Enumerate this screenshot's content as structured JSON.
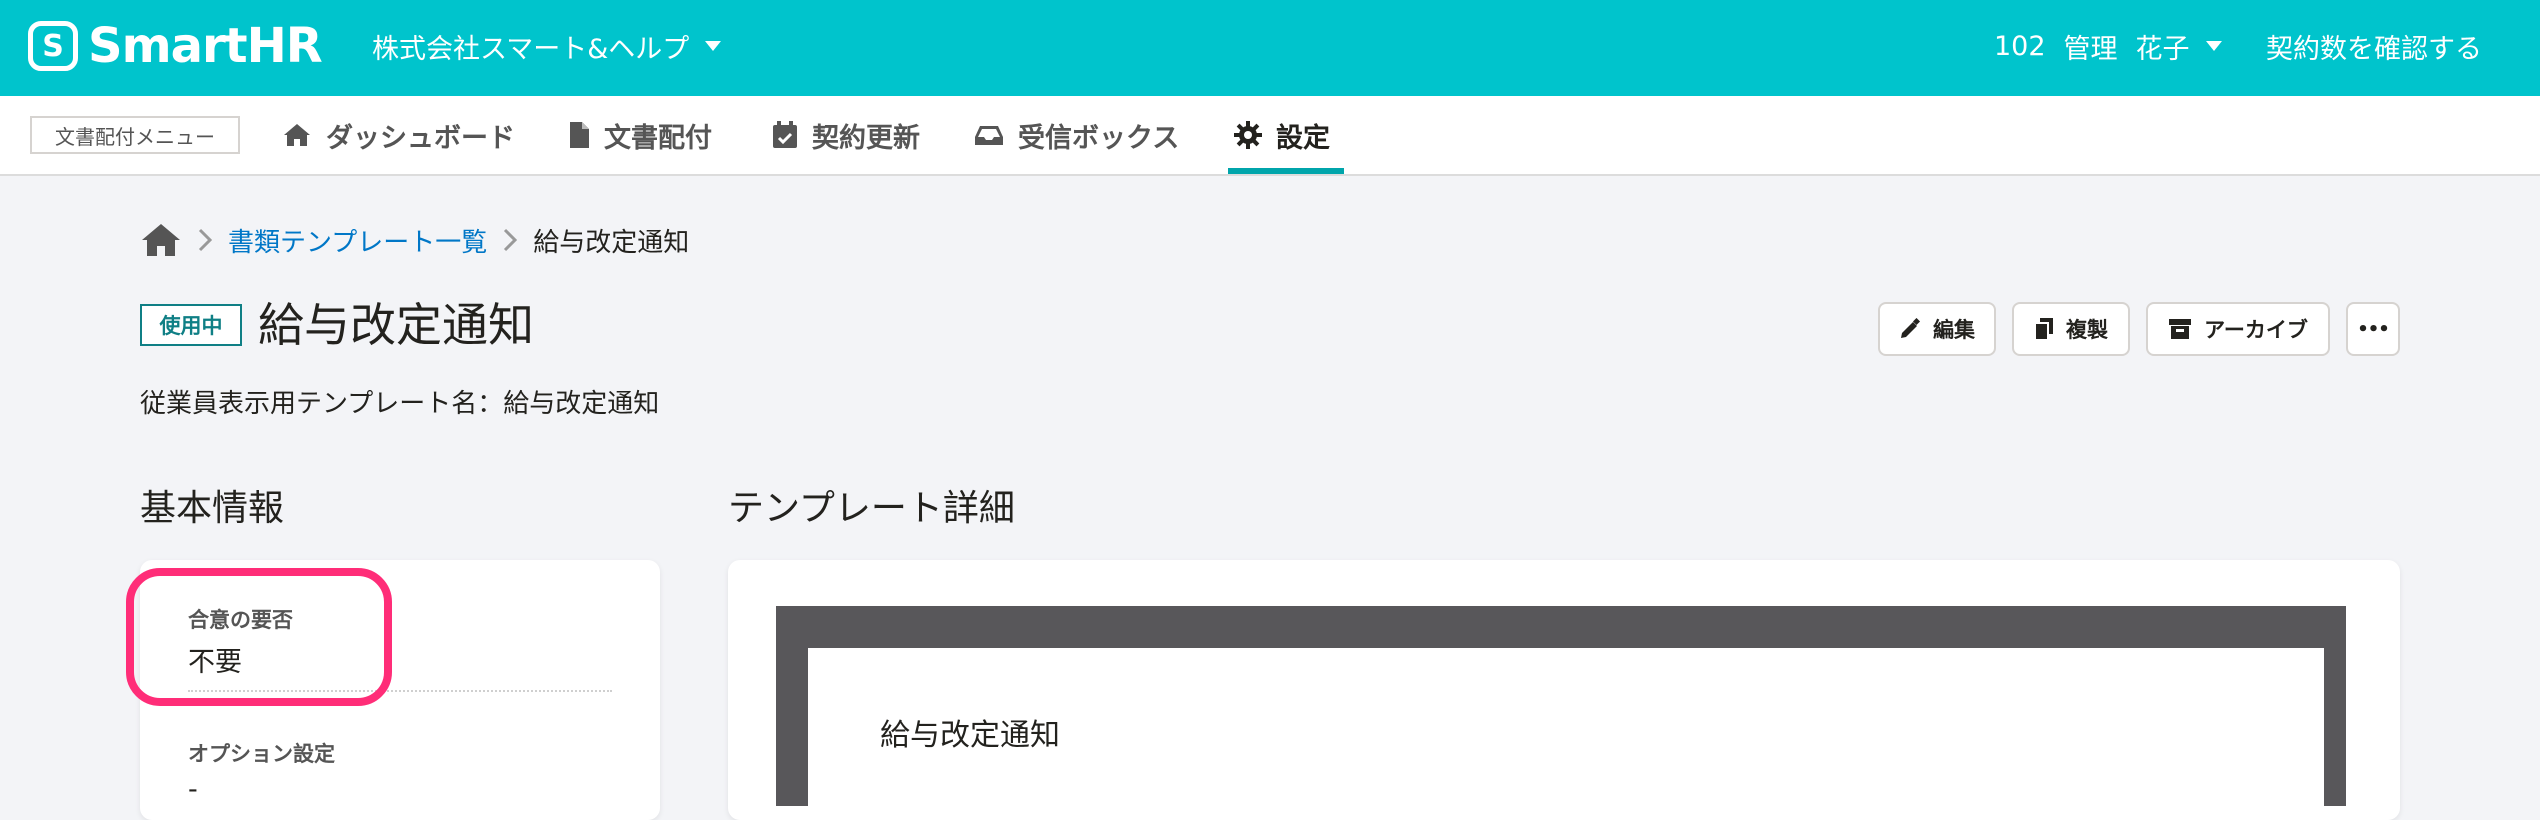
{
  "header": {
    "logo_text": "SmartHR",
    "company": "株式会社スマート&ヘルプ",
    "user_number": "102",
    "user_name_1": "管理",
    "user_name_2": "花子",
    "contract_link": "契約数を確認する"
  },
  "subnav": {
    "menu_label": "文書配付メニュー",
    "items": [
      {
        "label": "ダッシュボード",
        "icon": "home-icon"
      },
      {
        "label": "文書配付",
        "icon": "document-icon"
      },
      {
        "label": "契約更新",
        "icon": "calendar-check-icon"
      },
      {
        "label": "受信ボックス",
        "icon": "inbox-icon"
      },
      {
        "label": "設定",
        "icon": "gear-icon",
        "active": true
      }
    ]
  },
  "breadcrumb": {
    "home_icon": "home-icon",
    "link": "書類テンプレート一覧",
    "current": "給与改定通知"
  },
  "page": {
    "status": "使用中",
    "title": "給与改定通知",
    "employee_template_name": "従業員表示用テンプレート名：給与改定通知",
    "actions": {
      "edit": "編集",
      "duplicate": "複製",
      "archive": "アーカイブ",
      "more": "•••"
    }
  },
  "basic_info": {
    "title": "基本情報",
    "fields": [
      {
        "label": "合意の要否",
        "value": "不要"
      },
      {
        "label": "オプション設定",
        "value": "-"
      }
    ]
  },
  "template_detail": {
    "title": "テンプレート詳細",
    "document_title": "給与改定通知"
  },
  "colors": {
    "brand": "#00c4cc",
    "status_accent": "#0f7f85",
    "link": "#0077c7",
    "highlight": "#ff2d78"
  }
}
